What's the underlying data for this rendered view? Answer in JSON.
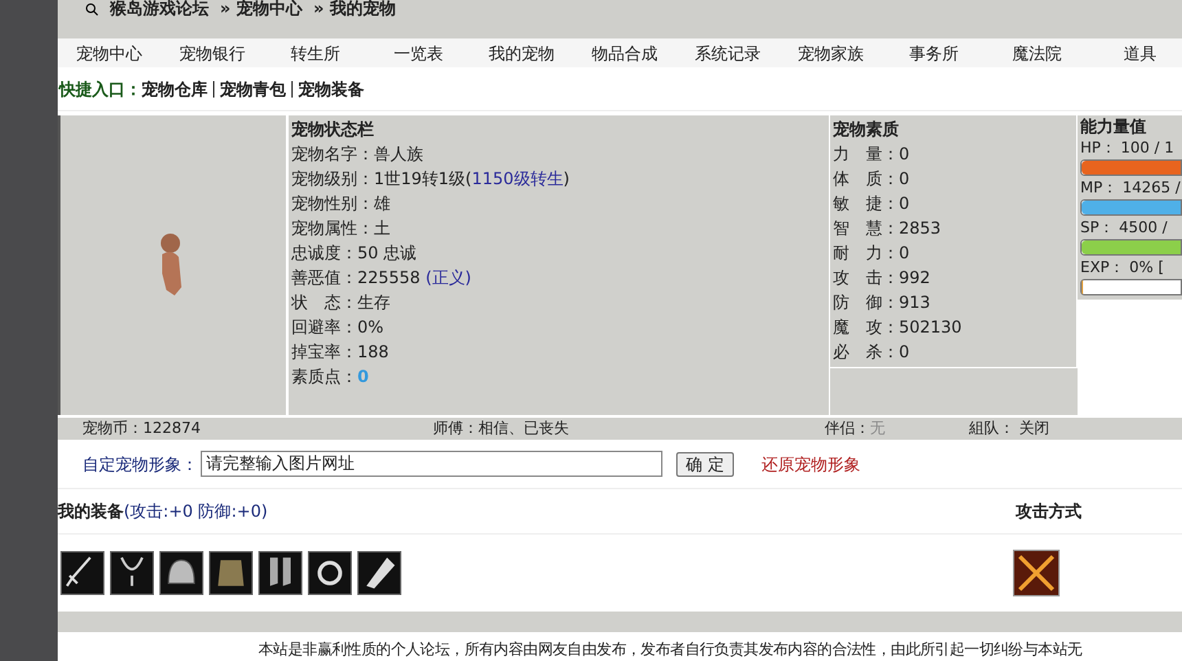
{
  "breadcrumb": [
    "猴岛游戏论坛",
    "» 宠物中心",
    "» 我的宠物"
  ],
  "nav": [
    "宠物中心",
    "宠物银行",
    "转生所",
    "一览表",
    "我的宠物",
    "物品合成",
    "系统记录",
    "宠物家族",
    "事务所",
    "魔法院",
    "道具"
  ],
  "quick_links": {
    "label": "快捷入口：",
    "links": [
      "宠物仓库",
      "宠物青包",
      "宠物装备"
    ]
  },
  "status": {
    "title": "宠物状态栏",
    "rows": [
      {
        "label": "宠物名字：",
        "value": "兽人族"
      },
      {
        "label": "宠物级别：",
        "value": "1世19转1级(",
        "link": "1150级转生",
        "after": ")"
      },
      {
        "label": "宠物性别：",
        "value": "雄"
      },
      {
        "label": "宠物属性：",
        "value": "土"
      },
      {
        "label": "忠诚度：",
        "value": "50 忠诚"
      },
      {
        "label": "善恶值：",
        "value": "225558 ",
        "link": "(正义)"
      },
      {
        "label": "状　态：",
        "value": "生存"
      },
      {
        "label": "回避率：",
        "value": "0%"
      },
      {
        "label": "掉宝率：",
        "value": "188"
      },
      {
        "label": "素质点：",
        "value": "0",
        "kind": "points"
      }
    ]
  },
  "quality": {
    "title": "宠物素质",
    "rows": [
      {
        "label": "力　量：",
        "value": "0"
      },
      {
        "label": "体　质：",
        "value": "0"
      },
      {
        "label": "敏　捷：",
        "value": "0"
      },
      {
        "label": "智　慧：",
        "value": "2853"
      },
      {
        "label": "耐　力：",
        "value": "0"
      },
      {
        "label": "攻　击：",
        "value": "992"
      },
      {
        "label": "防　御：",
        "value": "913"
      },
      {
        "label": "魔　攻：",
        "value": "502130"
      },
      {
        "label": "必　杀：",
        "value": "0"
      }
    ]
  },
  "ability": {
    "title": "能力量值",
    "meters": [
      {
        "label": "HP：  100 / 1",
        "level": 1,
        "color": "#e8641e"
      },
      {
        "label": "MP：  14265 /",
        "level": 1,
        "color": "#4fb0e8"
      },
      {
        "label": "SP：  4500 /",
        "level": 1,
        "color": "#8ccf4a"
      },
      {
        "label": "EXP：  0% [",
        "level": 0.02,
        "color": "#e0a040"
      }
    ]
  },
  "info_bar": {
    "coins": "宠物币：122874",
    "master": "师傅：相信、已丧失",
    "partner_label": "伴侣：",
    "partner": "无",
    "team": "組队：  关闭"
  },
  "custom_form": {
    "label": "自定宠物形象：",
    "value": "请完整输入图片网址",
    "button": "确 定",
    "reset_link": "还原宠物形象"
  },
  "equipment": {
    "title": "我的装备",
    "bonus": "(攻击:+0 防御:+0)",
    "items": [
      {
        "kind": "sword"
      },
      {
        "kind": "necklace"
      },
      {
        "kind": "helmet"
      },
      {
        "kind": "armor"
      },
      {
        "kind": "boots"
      },
      {
        "kind": "ring"
      },
      {
        "kind": "gauntlet"
      }
    ]
  },
  "attack_mode": {
    "title": "攻击方式"
  },
  "footer": "本站是非赢利性质的个人论坛，所有内容由网友自由发布，发布者自行负责其发布内容的合法性，由此所引起一切纠纷与本站无"
}
